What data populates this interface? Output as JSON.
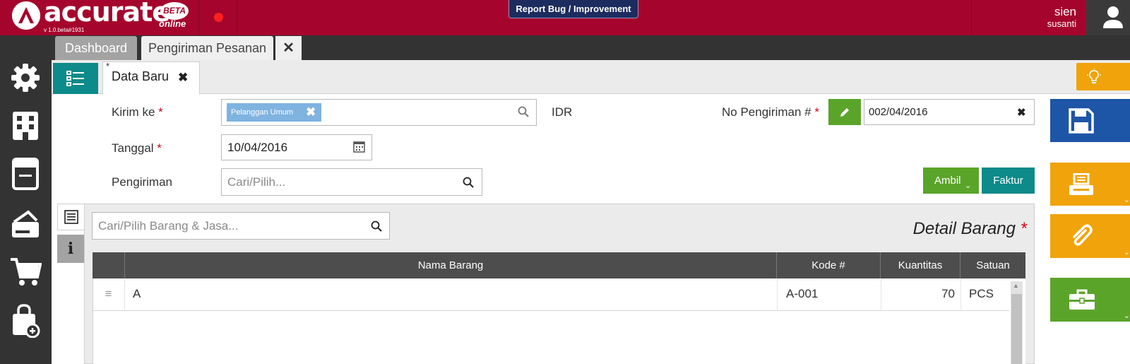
{
  "app": {
    "brand": "accurate",
    "beta_badge": "BETA",
    "online_label": "online",
    "version": "v 1.0.beta#1931",
    "report_button": "Report Bug / Improvement"
  },
  "user": {
    "first_name": "sien",
    "last_name": "susanti"
  },
  "tabs": [
    {
      "label": "Dashboard",
      "active": false
    },
    {
      "label": "Pengiriman Pesanan",
      "active": true
    }
  ],
  "subtab": {
    "modified_marker": "*",
    "label": "Data Baru"
  },
  "form": {
    "kirim_ke_label": "Kirim ke",
    "kirim_ke_chip": "Pelanggan Umum",
    "currency": "IDR",
    "no_pengiriman_label": "No Pengiriman #",
    "no_pengiriman_value": "002/04/2016",
    "tanggal_label": "Tanggal",
    "tanggal_value": "10/04/2016",
    "pengiriman_label": "Pengiriman",
    "pengiriman_placeholder": "Cari/Pilih...",
    "required_mark": "*"
  },
  "actions": {
    "ambil": "Ambil",
    "faktur": "Faktur"
  },
  "detail": {
    "search_placeholder": "Cari/Pilih Barang & Jasa...",
    "title": "Detail Barang",
    "columns": [
      "Nama Barang",
      "Kode #",
      "Kuantitas",
      "Satuan"
    ],
    "rows": [
      {
        "nama": "A",
        "kode": "A-001",
        "kuantitas": "70",
        "satuan": "PCS"
      }
    ]
  },
  "colors": {
    "topbar": "#a5052c",
    "teal": "#0d8a8a",
    "green": "#5ba42a",
    "orange": "#f0a30a",
    "blue": "#1d55a7"
  },
  "icons": {
    "sidebar": [
      "gear-icon",
      "building-icon",
      "ledger-icon",
      "payment-card-icon",
      "cart-icon",
      "bag-add-icon"
    ],
    "right_column": [
      "save-icon",
      "print-icon",
      "paperclip-icon",
      "toolbox-icon"
    ]
  }
}
